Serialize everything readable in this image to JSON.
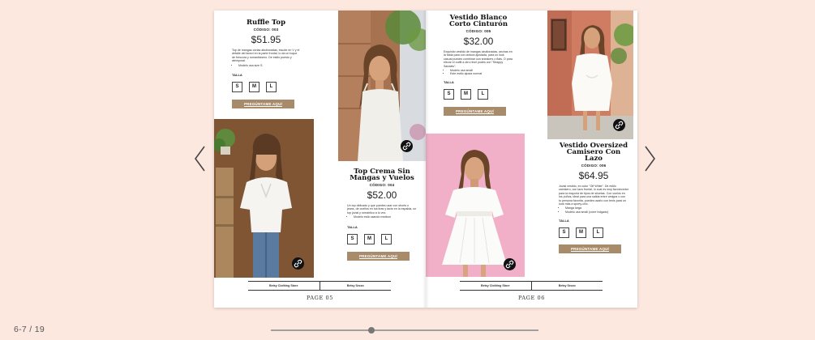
{
  "nav": {
    "prev_icon": "chevron-left-icon",
    "next_icon": "chevron-right-icon"
  },
  "pages": [
    {
      "number": "PAGE 05",
      "footer": [
        "Betsy Clothing Store",
        "Betsy Sezzo"
      ],
      "products": [
        {
          "name": "Ruffle Top",
          "code": "CÓDIGO: 003",
          "price": "$51.95",
          "desc": "Top de mangas cortas abullonadas, escote en V y el detalle del lacezi en la parte frontal, lo da un toque de frescura y romanticismo. De estilo puesto y atemporal.",
          "bullets": [
            "Modelo usa size S."
          ],
          "size_label": "TALLA",
          "sizes": [
            "S",
            "M",
            "L"
          ],
          "cta": "PREGÚNTAME AQUÍ"
        },
        {
          "name": "Top Crema Sin Mangas y Vuelos",
          "code": "CÓDIGO: 004",
          "price": "$52.00",
          "desc": "Un top delicado y que puedes usar con shorts o jeans, de cuellos en tus tiras y tacto en la espalda, un top jovial y romántico a tu vez.",
          "bullets": [
            "Modelo está usando medium"
          ],
          "size_label": "TALLA",
          "sizes": [
            "S",
            "M",
            "L"
          ],
          "cta": "PREGÚNTAME AQUÍ"
        }
      ]
    },
    {
      "number": "PAGE 06",
      "footer": [
        "Betsy Clothing Store",
        "Betsy Sezzo"
      ],
      "products": [
        {
          "name": "Vestido Blanco Corto Cinturón",
          "code": "CÓDIGO: 005",
          "price": "$32.00",
          "desc": "Exquisito vestido de mangas abullonadas, anchas en la falda para con cintura ajustada, para un look casual puedes combinar con sneakers o flats. O para elevar el outfit a otro nivel podés con \"Strappy Sandals\".",
          "bullets": [
            "Modelo usa small",
            "Este estilo ajusta normal"
          ],
          "size_label": "TALLA",
          "sizes": [
            "S",
            "M",
            "L"
          ],
          "cta": "PREGÚNTAME AQUÍ"
        },
        {
          "name": "Vestido Oversized Camisero Con Lazo",
          "code": "CÓDIGO: 006",
          "price": "$64.95",
          "desc": "Jovial vestido, en color \"Off White\". De estilo camisero, con lazo frontal, lo cual es muy favorecedor para la mayoría de tipos de siluetas. Con vuelos en los puños, ideal para una salida entre amigos o con tu persona favorita, puedes usarlo con tenis para un look más a sporty-chic.",
          "bullets": [
            "Manga larga",
            "Modelo usa small (corre holgado)"
          ],
          "size_label": "TALLA",
          "sizes": [
            "S",
            "M",
            "L"
          ],
          "cta": "PREGÚNTAME AQUÍ"
        }
      ]
    }
  ],
  "counter": "6-7 / 19",
  "progress": 0.375,
  "colors": {
    "background": "#fde8e0",
    "cta": "#a88b6a",
    "slider": "#777777"
  }
}
